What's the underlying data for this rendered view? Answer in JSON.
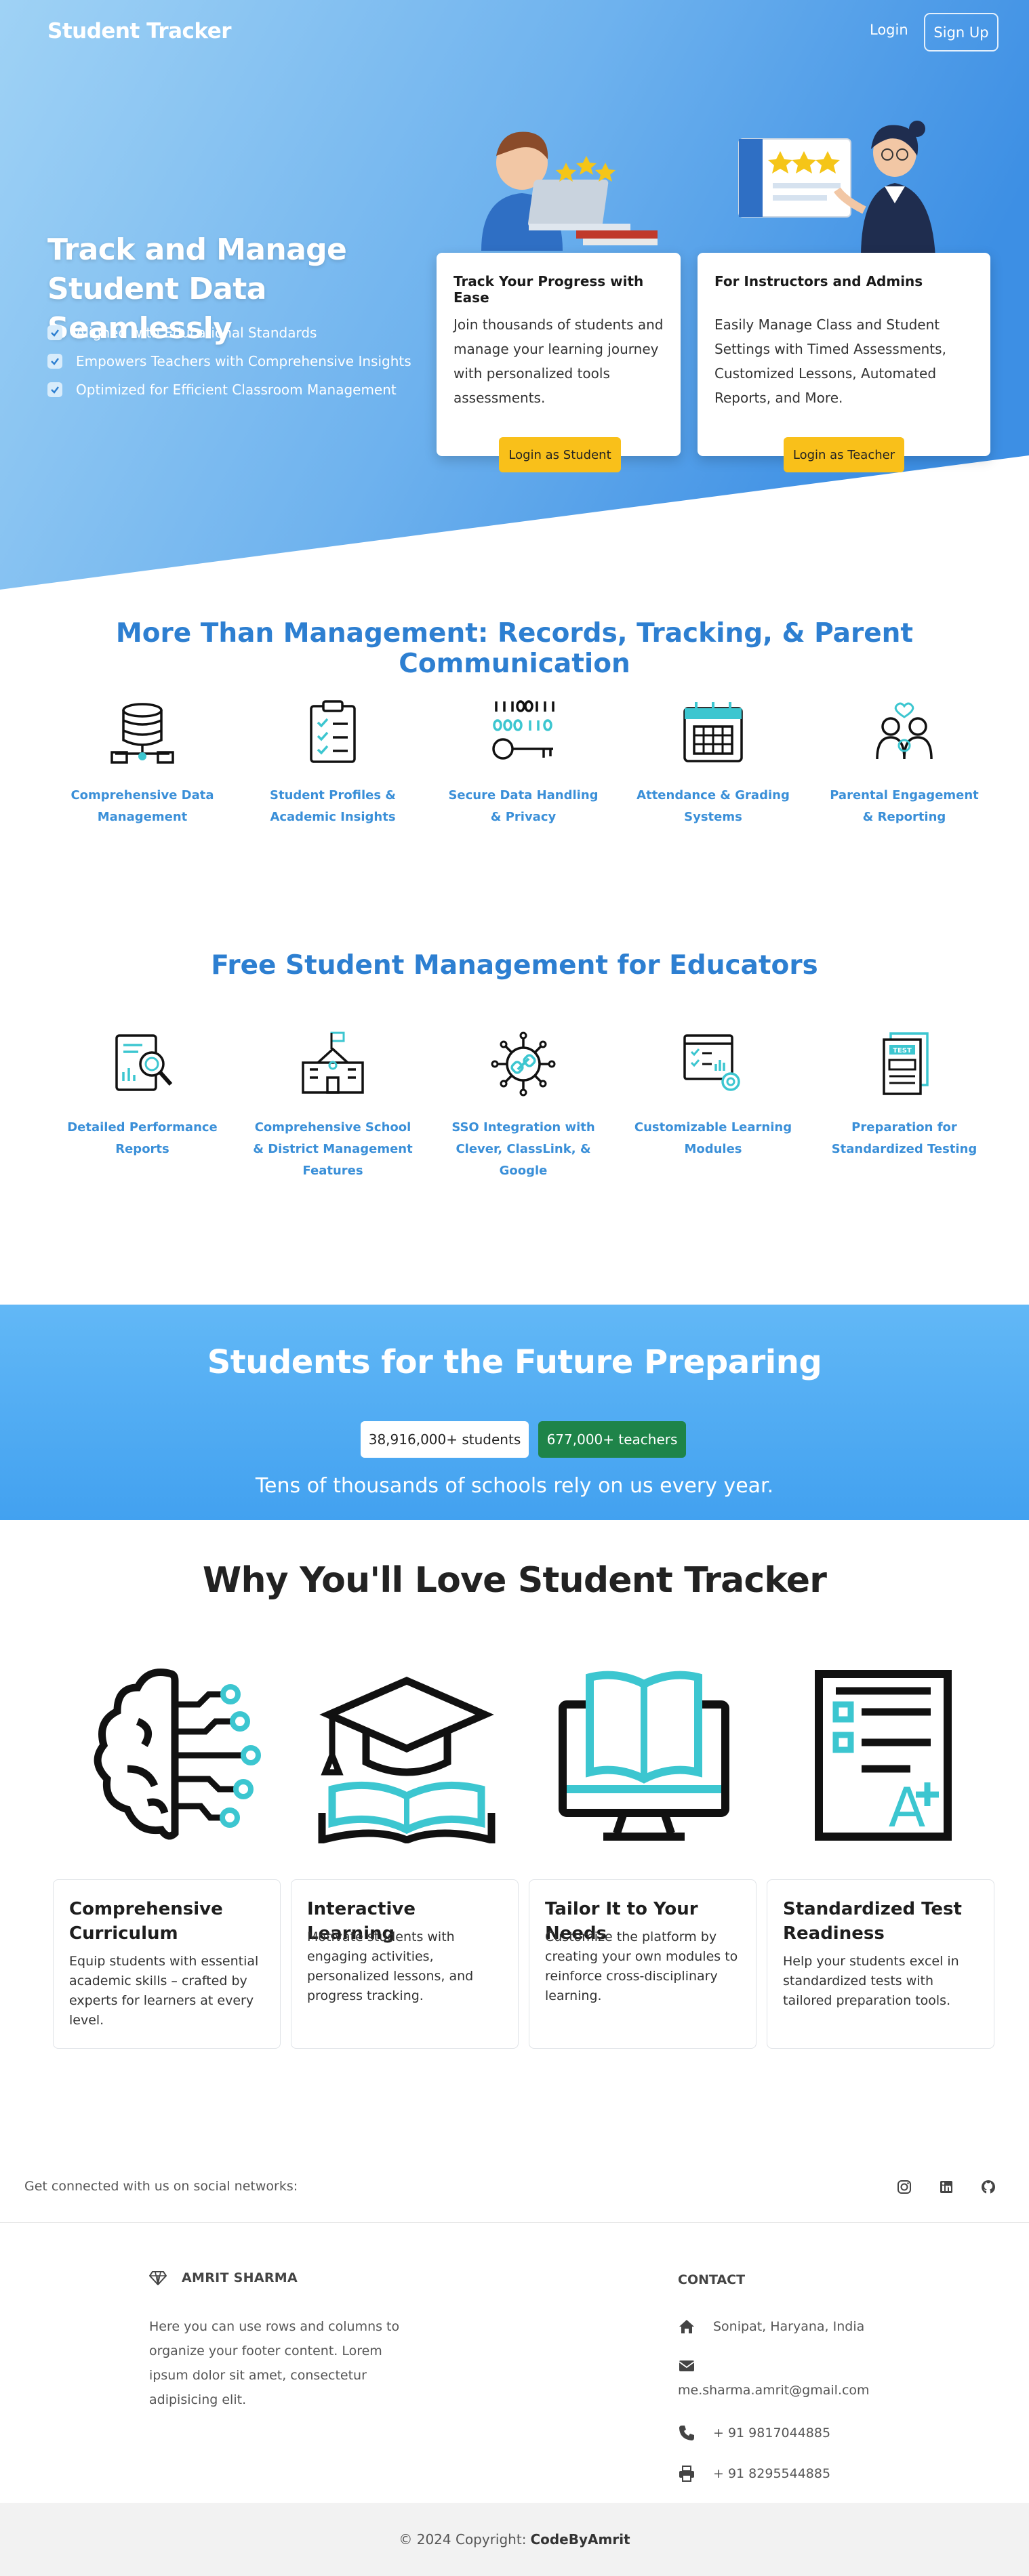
{
  "nav": {
    "brand": "Student Tracker",
    "login": "Login",
    "signup": "Sign Up"
  },
  "hero": {
    "title": "Track and Manage Student Data Seamlessly",
    "checks": [
      "Aligned with Educational Standards",
      "Empowers Teachers with Comprehensive Insights",
      "Optimized for Efficient Classroom Management"
    ],
    "cards": [
      {
        "title": "Track Your Progress with Ease",
        "text": "Join thousands of students and manage your learning journey with personalized tools assessments.",
        "button": "Login as Student"
      },
      {
        "title": "For Instructors and Admins",
        "text": "Easily Manage Class and Student Settings with Timed Assessments, Customized Lessons, Automated Reports, and More.",
        "button": "Login as Teacher"
      }
    ]
  },
  "management": {
    "title": "More Than Management: Records, Tracking, & Parent Communication",
    "items": [
      {
        "label": "Comprehensive Data Management",
        "icon": "database-icon"
      },
      {
        "label": "Student Profiles & Academic Insights",
        "icon": "clipboard-checklist-icon"
      },
      {
        "label": "Secure Data Handling & Privacy",
        "icon": "binary-key-icon"
      },
      {
        "label": "Attendance & Grading Systems",
        "icon": "calendar-icon"
      },
      {
        "label": "Parental Engagement & Reporting",
        "icon": "parents-icon"
      }
    ]
  },
  "free": {
    "title": "Free Student Management for Educators",
    "items": [
      {
        "label": "Detailed Performance Reports",
        "icon": "report-magnifier-icon"
      },
      {
        "label": "Comprehensive School & District Management Features",
        "icon": "school-building-icon"
      },
      {
        "label": "SSO Integration with Clever, ClassLink, & Google",
        "icon": "sso-link-icon"
      },
      {
        "label": "Customizable Learning Modules",
        "icon": "settings-dashboard-icon"
      },
      {
        "label": "Preparation for Standardized Testing",
        "icon": "test-paper-icon"
      }
    ]
  },
  "banner": {
    "title": "Students for the Future Preparing",
    "students": "38,916,000+ students",
    "teachers": "677,000+ teachers",
    "subtitle": "Tens of thousands of schools rely on us every year."
  },
  "why": {
    "title": "Why You'll Love Student Tracker",
    "cards": [
      {
        "title": "Comprehensive Curriculum",
        "text": "Equip students with essential academic skills – crafted by experts for learners at every level.",
        "icon": "brain-circuit-icon"
      },
      {
        "title": "Interactive Learning",
        "text": "Motivate students with engaging activities, personalized lessons, and progress tracking.",
        "icon": "graduation-cap-book-icon"
      },
      {
        "title": "Tailor It to Your Needs",
        "text": "Customize the platform by creating your own modules to reinforce cross-disciplinary learning.",
        "icon": "monitor-book-icon"
      },
      {
        "title": "Standardized Test Readiness",
        "text": "Help your students excel in standardized tests with tailored preparation tools.",
        "icon": "graded-paper-icon"
      }
    ]
  },
  "footer": {
    "social_text": "Get connected with us on social networks:",
    "social_icons": [
      "instagram-icon",
      "linkedin-icon",
      "github-icon"
    ],
    "brand": "AMRIT SHARMA",
    "about": "Here you can use rows and columns to organize your footer content. Lorem ipsum dolor sit amet, consectetur adipisicing elit.",
    "contact_heading": "CONTACT",
    "address": "Sonipat, Haryana, India",
    "email": "me.sharma.amrit@gmail.com",
    "phone": "+ 91 9817044885",
    "fax": "+ 91 8295544885",
    "copyright": "© 2024 Copyright:",
    "copyright_name": "CodeByAmrit"
  },
  "colors": {
    "accent": "#2d7fd1",
    "yellow": "#f9c01a",
    "green": "#1e8449",
    "teal": "#3cc6d0"
  }
}
